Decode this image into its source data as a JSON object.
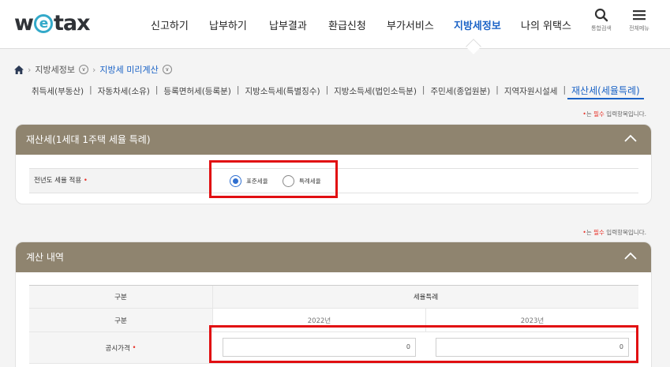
{
  "header": {
    "logo_pre": "w",
    "logo_e": "e",
    "logo_post": "tax",
    "nav": [
      "신고하기",
      "납부하기",
      "납부결과",
      "환급신청",
      "부가서비스",
      "지방세정보",
      "나의 위택스"
    ],
    "active_nav": "지방세정보",
    "search_label": "통합검색",
    "menu_label": "전체메뉴"
  },
  "breadcrumb": {
    "level1": "지방세정보",
    "level2": "지방세 미리계산"
  },
  "tabs": [
    "취득세(부동산)",
    "자동차세(소유)",
    "등록면허세(등록분)",
    "지방소득세(특별징수)",
    "지방소득세(법인소득분)",
    "주민세(종업원분)",
    "지역자원시설세",
    "재산세(세율특례)"
  ],
  "required_note": {
    "mark": "•",
    "pre": "는 ",
    "bold": "필수",
    "post": " 입력항목입니다."
  },
  "section1": {
    "title": "재산세(1세대 1주택 세율 특례)",
    "row_label": "전년도 세율 적용",
    "options": [
      "표준세율",
      "특례세율"
    ],
    "selected": "표준세율"
  },
  "section2": {
    "title": "계산 내역",
    "header_col1": "구분",
    "header_col2": "세율특례",
    "sub_label": "구분",
    "years": [
      "2022년",
      "2023년"
    ],
    "price_label": "공시가격",
    "price_values": [
      "0",
      "0"
    ]
  },
  "colors": {
    "accent": "#1b63c6",
    "panel_header": "#8f846f",
    "required": "#e8342b",
    "highlight": "#e10f12"
  }
}
